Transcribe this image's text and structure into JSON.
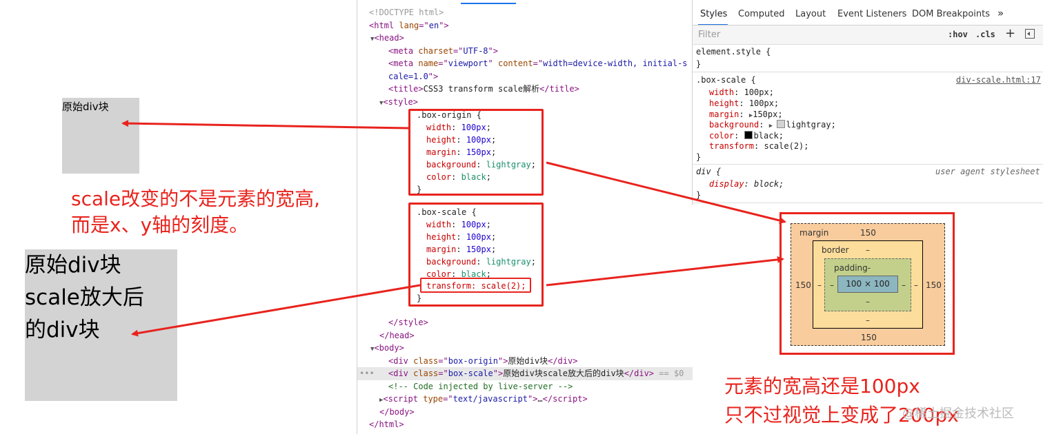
{
  "preview": {
    "origin_text": "原始div块",
    "scale_text_lines": [
      "原始div块",
      "scale放大后",
      "的div块"
    ]
  },
  "notes": {
    "left_lines": [
      "scale改变的不是元素的宽高,",
      "而是x、y轴的刻度。"
    ],
    "right_lines": [
      "元素的宽高还是100px",
      "只不过视觉上变成了200px"
    ],
    "watermark": "@稀土掘金技术社区"
  },
  "elements_panel": {
    "doctype": "<!DOCTYPE html>",
    "html_open": {
      "tag": "html",
      "attr": "lang",
      "value": "en"
    },
    "head_tag": "head",
    "meta1": {
      "attr": "charset",
      "value": "UTF-8"
    },
    "meta2": {
      "attr1": "name",
      "value1": "viewport",
      "attr2": "content",
      "value2_line1": "width=device-width, initial-s",
      "value2_line2": "cale=1.0"
    },
    "title": "CSS3 transform scale解析",
    "style_tag": "style",
    "box_origin": {
      "selector": ".box-origin {",
      "props": [
        {
          "name": "width",
          "value": "100px"
        },
        {
          "name": "height",
          "value": "100px"
        },
        {
          "name": "margin",
          "value": "150px"
        },
        {
          "name": "background",
          "value": "lightgray"
        },
        {
          "name": "color",
          "value": "black"
        }
      ]
    },
    "box_scale": {
      "selector": ".box-scale {",
      "props": [
        {
          "name": "width",
          "value": "100px"
        },
        {
          "name": "height",
          "value": "100px"
        },
        {
          "name": "margin",
          "value": "150px"
        },
        {
          "name": "background",
          "value": "lightgray"
        },
        {
          "name": "color",
          "value": "black"
        }
      ],
      "transform": "transform: scale(2);"
    },
    "close_brace": "}",
    "style_close": "</style>",
    "head_close": "</head>",
    "body_tag": "body",
    "div1": {
      "class": "box-origin",
      "text": "原始div块"
    },
    "div2": {
      "class": "box-scale",
      "text": "原始div块scale放大后的div块",
      "selected_suffix": "== $0"
    },
    "comment": "<!-- Code injected by live-server -->",
    "script": {
      "type": "text/javascript",
      "ellipsis": "…"
    },
    "body_close": "</body>",
    "html_close": "</html>",
    "row_dots": "•••"
  },
  "styles_panel": {
    "tabs": [
      "Styles",
      "Computed",
      "Layout",
      "Event Listeners",
      "DOM Breakpoints",
      "»"
    ],
    "filter_placeholder": "Filter",
    "hov": ":hov",
    "cls": ".cls",
    "plus": "+",
    "element_style": "element.style {",
    "close_brace": "}",
    "rule_selector": ".box-scale {",
    "rule_source": "div-scale.html:17",
    "rule_props": [
      {
        "name": "width",
        "value": "100px;"
      },
      {
        "name": "height",
        "value": "100px;"
      },
      {
        "name": "margin",
        "value": "150px;"
      },
      {
        "name": "background",
        "value": "lightgray;"
      },
      {
        "name": "color",
        "value": "black;"
      },
      {
        "name": "transform",
        "value": "scale(2);"
      }
    ],
    "ua_selector": "div {",
    "ua_source": "user agent stylesheet",
    "ua_prop": {
      "name": "display",
      "value": "block;"
    }
  },
  "box_model": {
    "margin_label": "margin",
    "margin_top": "150",
    "margin_left": "150",
    "margin_right": "150",
    "margin_bottom": "150",
    "border_label": "border",
    "border_top": "–",
    "border_left": "–",
    "border_right": "–",
    "border_bottom": "–",
    "padding_label": "padding-",
    "padding_left": "–",
    "padding_right": "–",
    "padding_bottom": "–",
    "content": "100 × 100"
  },
  "colors": {
    "annotation": "#e8231d",
    "lightgray": "#d3d3d3",
    "black": "#000000"
  }
}
